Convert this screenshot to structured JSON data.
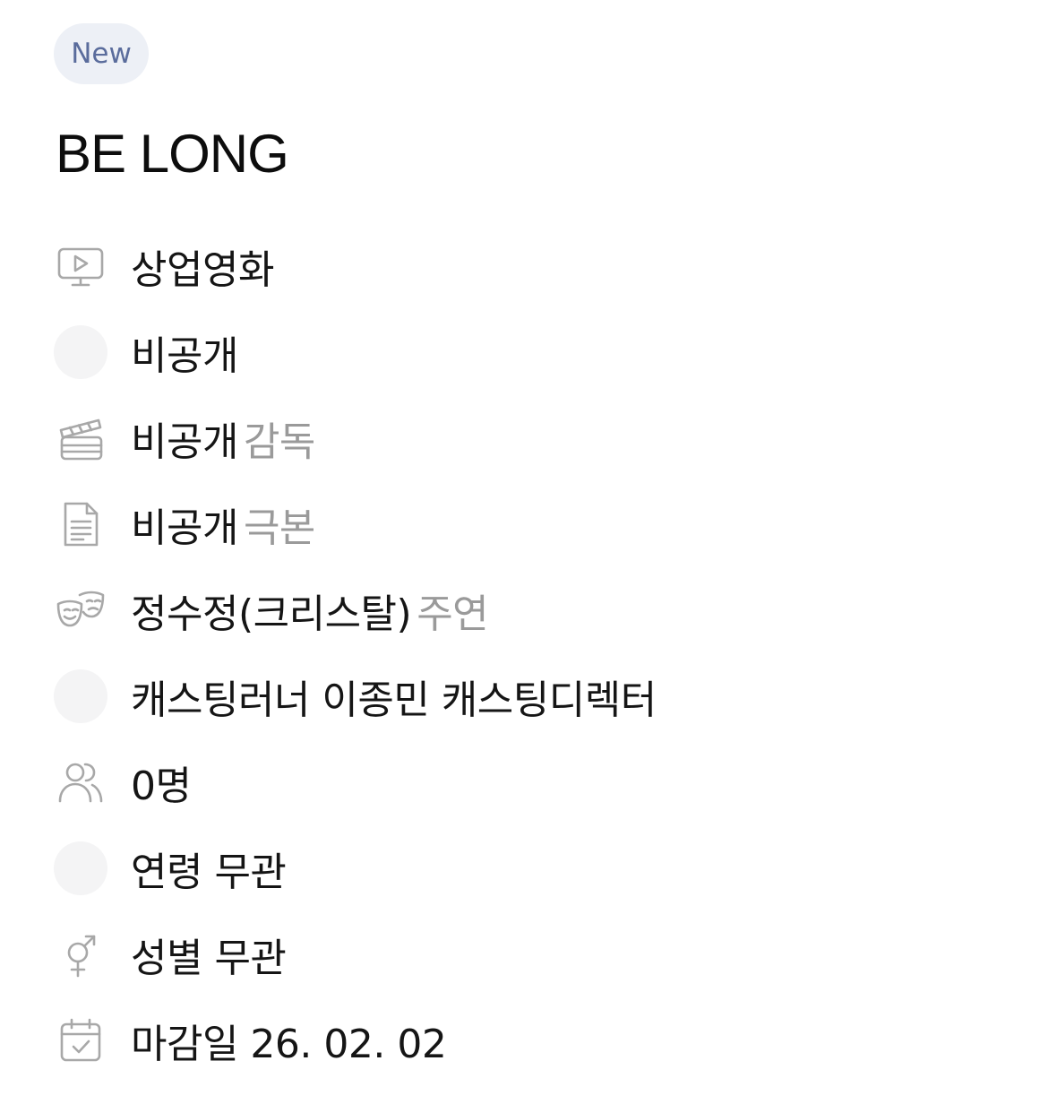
{
  "badge": "New",
  "title": "BE LONG",
  "rows": {
    "category": {
      "icon": "monitor-play-icon",
      "text": "상업영화"
    },
    "company": {
      "icon": "blank-avatar",
      "text": "비공개"
    },
    "director": {
      "icon": "clapperboard-icon",
      "text": "비공개",
      "suffix": "감독"
    },
    "writer": {
      "icon": "document-icon",
      "text": "비공개",
      "suffix": "극본"
    },
    "lead": {
      "icon": "theater-masks-icon",
      "text": "정수정(크리스탈)",
      "suffix": "주연"
    },
    "casting": {
      "icon": "blank-avatar",
      "text": "캐스팅러너 이종민 캐스팅디렉터"
    },
    "headcount": {
      "icon": "users-icon",
      "text": "0명"
    },
    "age": {
      "icon": "blank-avatar",
      "text": "연령 무관"
    },
    "gender": {
      "icon": "gender-icon",
      "text": "성별 무관"
    },
    "deadline": {
      "icon": "calendar-check-icon",
      "text": "마감일 26. 02. 02"
    }
  },
  "colors": {
    "badge_bg": "#edf0f6",
    "badge_text": "#5a6c9c",
    "icon_stroke": "#a8a8a8",
    "muted_text": "#9a9a9a",
    "placeholder_bg": "#f4f4f5"
  }
}
